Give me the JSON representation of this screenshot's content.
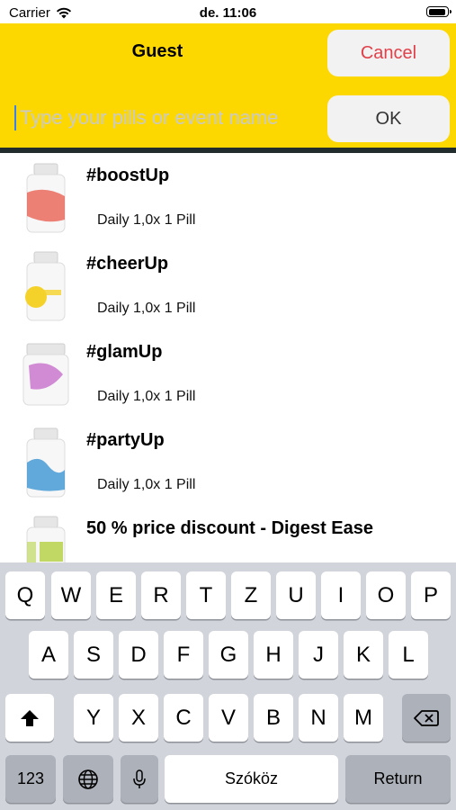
{
  "status": {
    "carrier": "Carrier",
    "time": "de. 11:06"
  },
  "header": {
    "title": "Guest",
    "cancel_label": "Cancel",
    "ok_label": "OK",
    "search_placeholder": "Type your pills or event name",
    "accent_color": "#fcd800"
  },
  "pills": [
    {
      "name": "#boostUp",
      "dose": "Daily 1,0x 1 Pill",
      "label_color": "#e8584a"
    },
    {
      "name": "#cheerUp",
      "dose": "Daily 1,0x 1 Pill",
      "label_color": "#f5d22a"
    },
    {
      "name": "#glamUp",
      "dose": "Daily 1,0x 1 Pill",
      "label_color": "#c05bc5"
    },
    {
      "name": "#partyUp",
      "dose": "Daily 1,0x 1 Pill",
      "label_color": "#2f8fd0"
    },
    {
      "name": "50 % price discount - Digest Ease",
      "dose": "",
      "label_color": "#b7d44a"
    }
  ],
  "keyboard": {
    "row1": [
      "Q",
      "W",
      "E",
      "R",
      "T",
      "Z",
      "U",
      "I",
      "O",
      "P"
    ],
    "row2": [
      "A",
      "S",
      "D",
      "F",
      "G",
      "H",
      "J",
      "K",
      "L"
    ],
    "row3": [
      "Y",
      "X",
      "C",
      "V",
      "B",
      "N",
      "M"
    ],
    "numbers_label": "123",
    "space_label": "Szóköz",
    "return_label": "Return"
  }
}
